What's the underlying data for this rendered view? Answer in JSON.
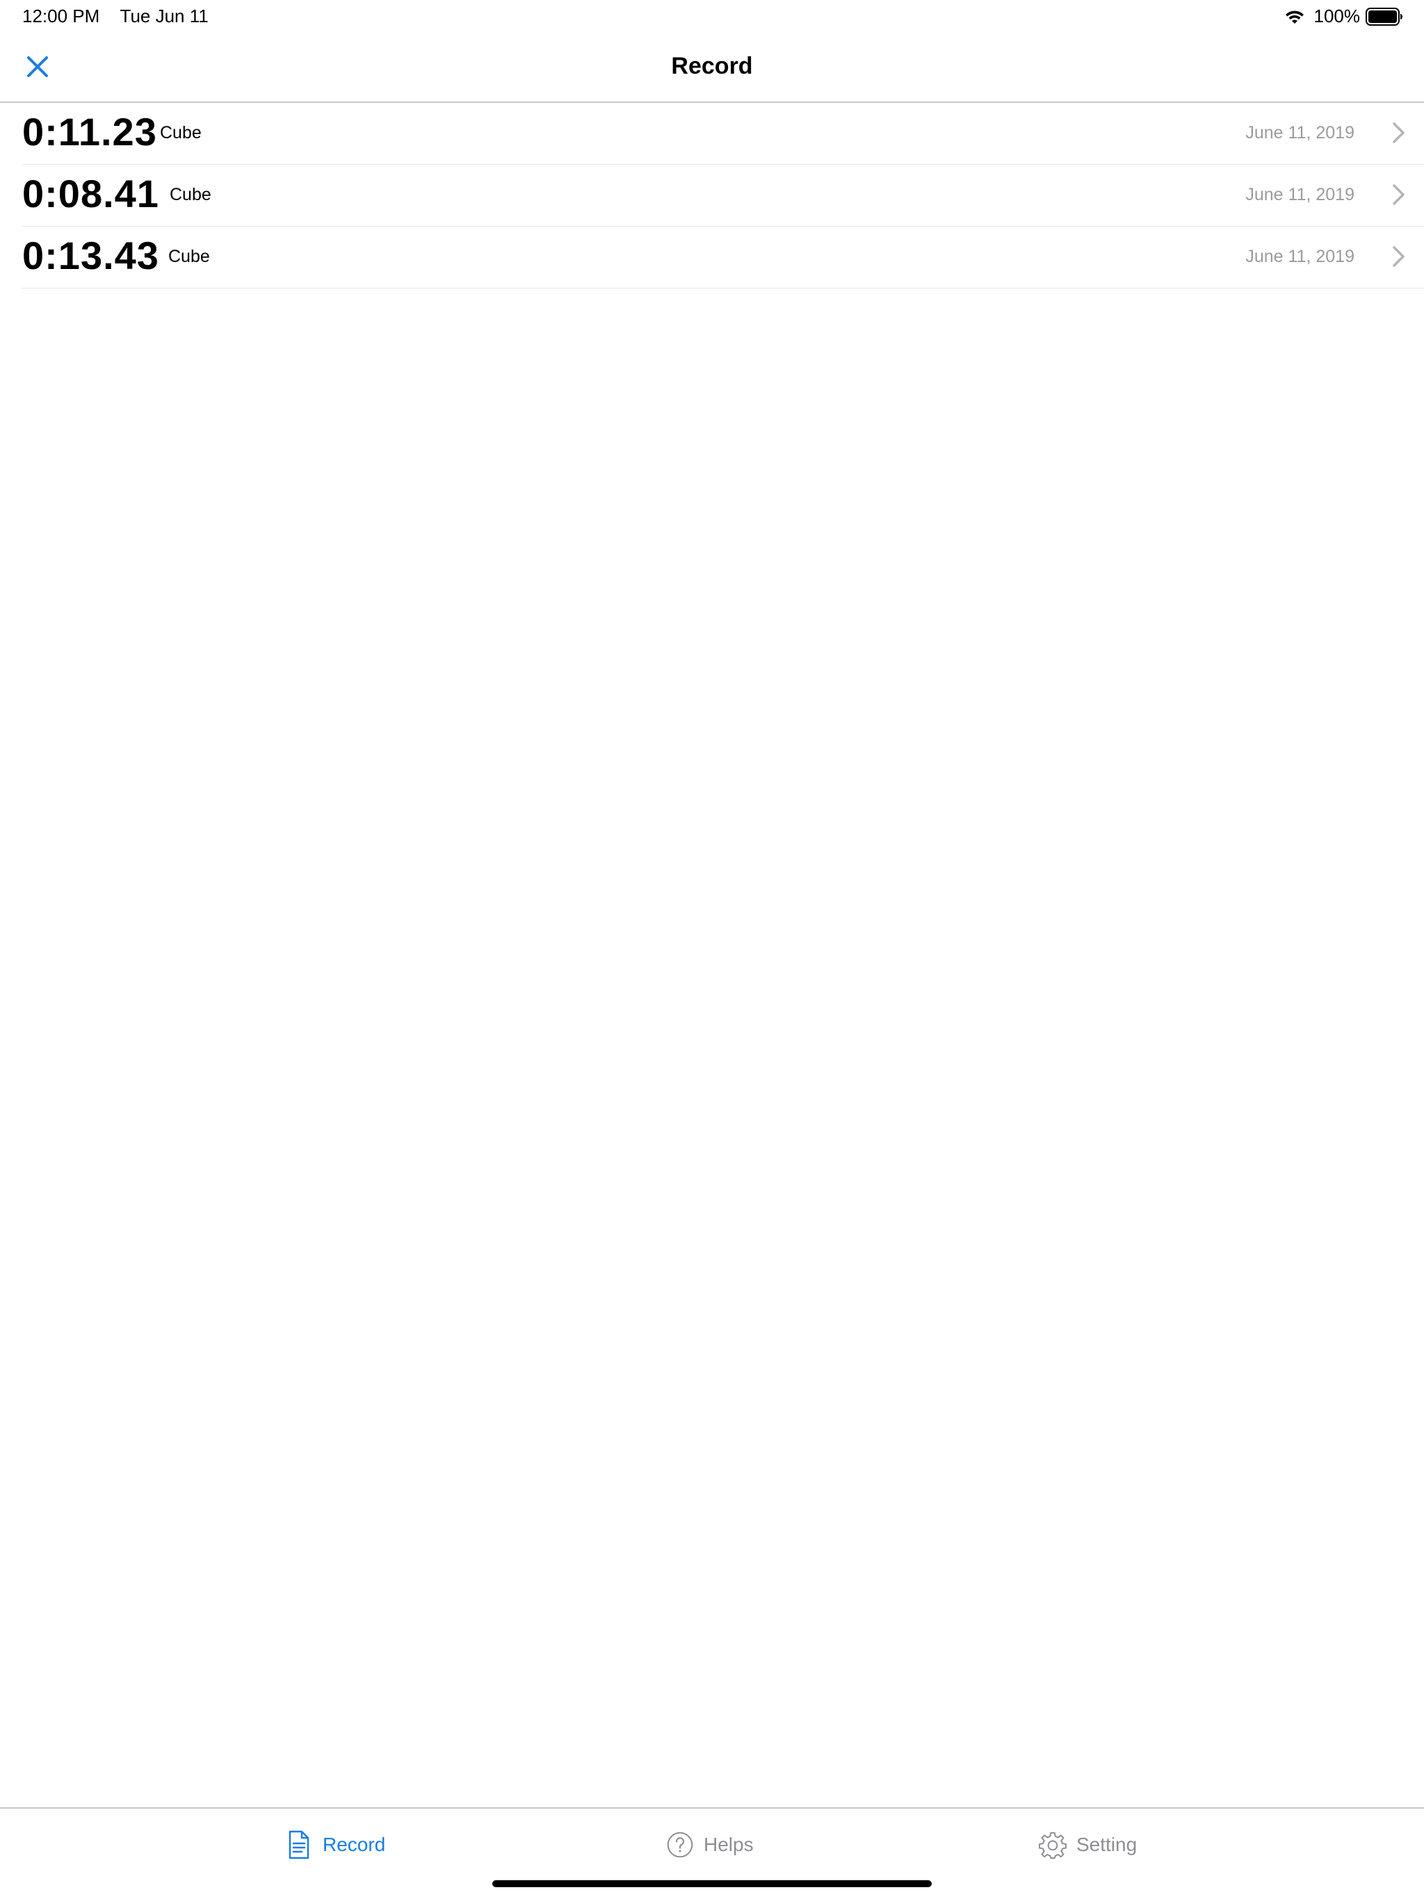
{
  "status_bar": {
    "time": "12:00 PM",
    "date": "Tue Jun 11",
    "battery": "100%"
  },
  "nav": {
    "title": "Record",
    "close_icon": "close-icon"
  },
  "records": [
    {
      "time": "0:11.23",
      "category": "Cube",
      "date": "June 11, 2019"
    },
    {
      "time": "0:08.41",
      "category": "Cube",
      "date": "June 11, 2019"
    },
    {
      "time": "0:13.43",
      "category": "Cube",
      "date": "June 11, 2019"
    }
  ],
  "tab_bar": {
    "tabs": [
      {
        "label": "Record",
        "icon": "document-icon",
        "active": true
      },
      {
        "label": "Helps",
        "icon": "question-circle-icon",
        "active": false
      },
      {
        "label": "Setting",
        "icon": "gear-icon",
        "active": false
      }
    ]
  },
  "colors": {
    "accent": "#1a7de4",
    "secondary_text": "#9b9b9e",
    "inactive_tab": "#8e8e93"
  }
}
